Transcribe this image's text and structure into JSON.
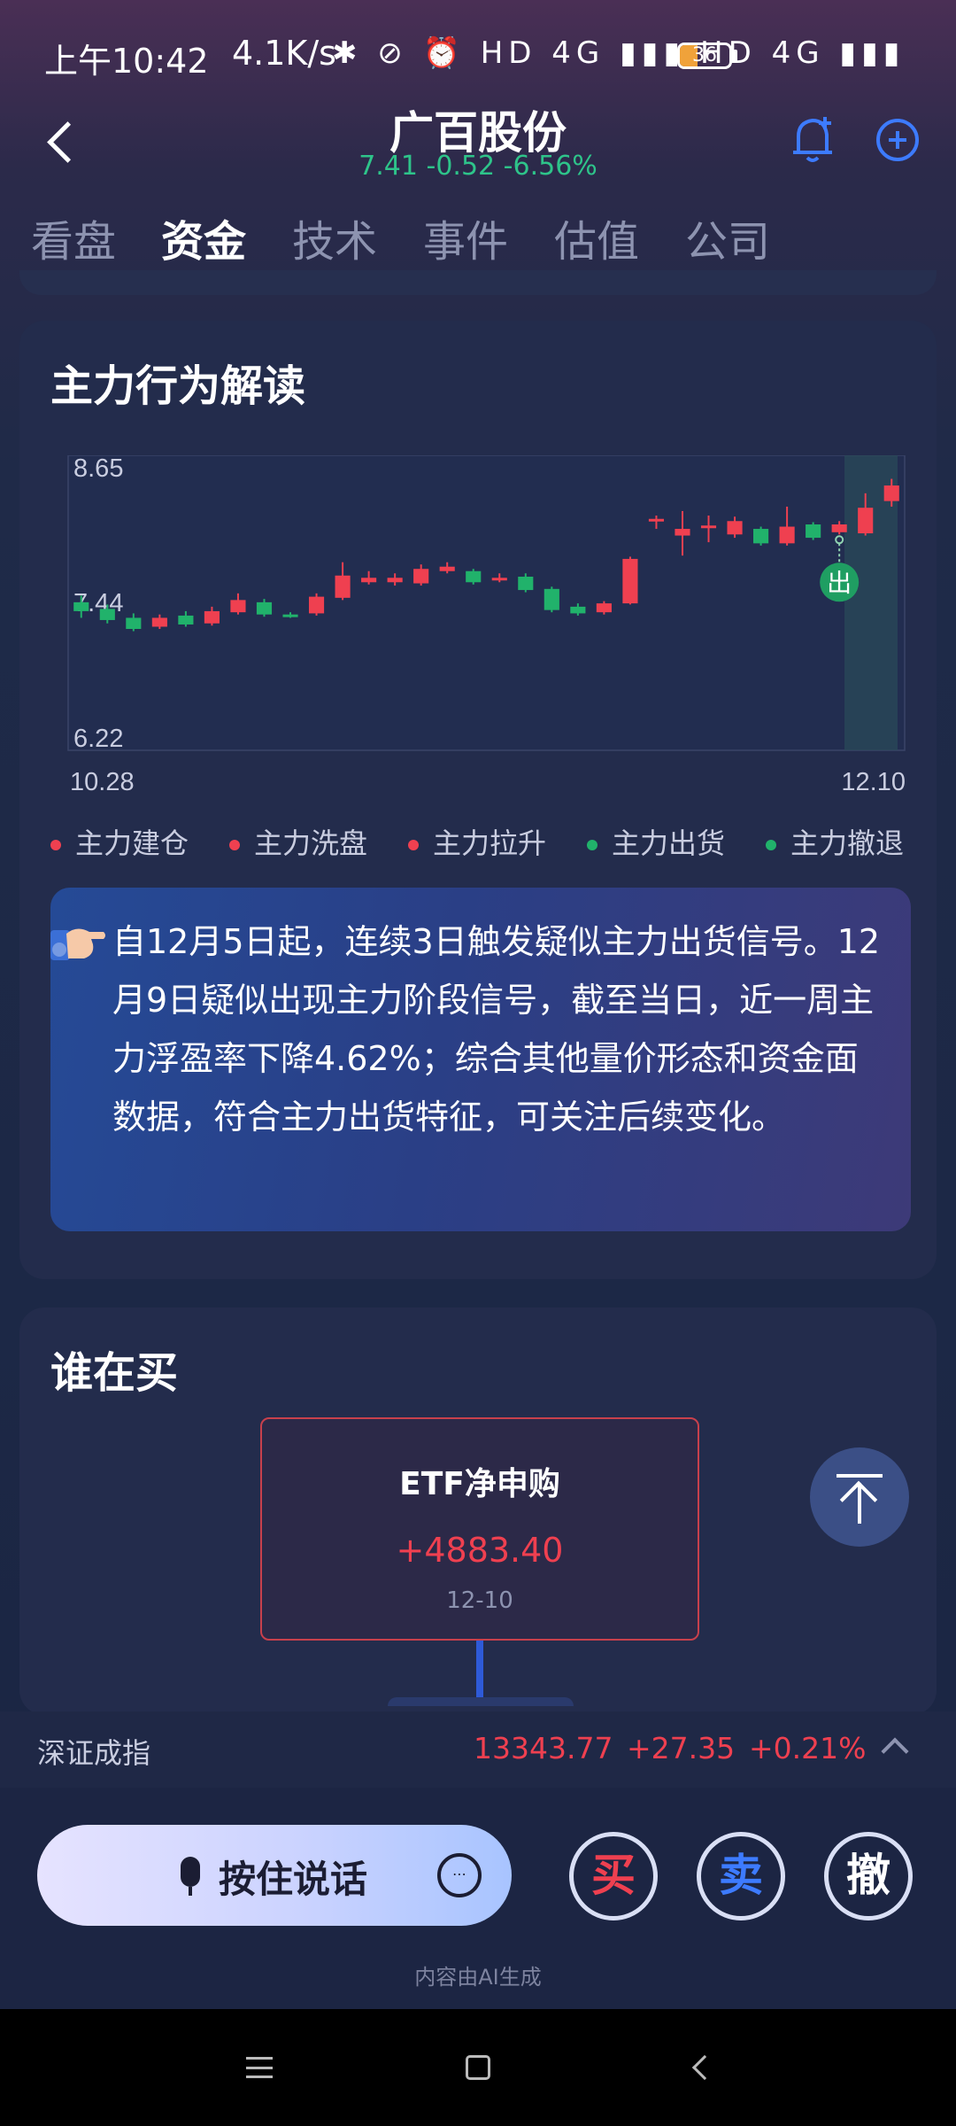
{
  "status_bar": {
    "time": "上午10:42",
    "net_rate": "4.1K/s",
    "indicators": "✱ ⊘ ⏰ HD 4G ▮▮▮ HD 4G ▮▮▮",
    "battery": "36",
    "battery_level": 0.36,
    "battery_color": "#f0a23a"
  },
  "header": {
    "stock_name": "广百股份",
    "quote": "7.41 -0.52 -6.56%",
    "quote_color": "#2ec48a",
    "icons": [
      "back-icon",
      "bell-plus-icon",
      "add-icon"
    ]
  },
  "tabs": [
    {
      "label": "看盘",
      "active": false
    },
    {
      "label": "资金",
      "active": true
    },
    {
      "label": "技术",
      "active": false
    },
    {
      "label": "事件",
      "active": false
    },
    {
      "label": "估值",
      "active": false
    },
    {
      "label": "公司",
      "active": false
    }
  ],
  "behavior_card": {
    "title": "主力行为解读",
    "legend": [
      {
        "label": "主力建仓",
        "color": "#ef4050"
      },
      {
        "label": "主力洗盘",
        "color": "#ef4050"
      },
      {
        "label": "主力拉升",
        "color": "#ef4050"
      },
      {
        "label": "主力出货",
        "color": "#21b26b"
      },
      {
        "label": "主力撤退",
        "color": "#21b26b"
      }
    ],
    "insight_text": "自12月5日起，连续3日触发疑似主力出货信号。12月9日疑似出现主力阶段信号，截至当日，近一周主力浮盈率下降4.62%；综合其他量价形态和资金面数据，符合主力出货特征，可关注后续变化。"
  },
  "chart_data": {
    "type": "candlestick",
    "title": "",
    "x_start_label": "10.28",
    "x_end_label": "12.10",
    "y_ticks": [
      "8.65",
      "7.44",
      "6.22"
    ],
    "ylim": [
      6.22,
      8.65
    ],
    "up_color": "#ef4050",
    "down_color": "#21b26b",
    "candles": [
      {
        "o": 7.44,
        "c": 7.36,
        "h": 7.5,
        "l": 7.3
      },
      {
        "o": 7.38,
        "c": 7.28,
        "h": 7.42,
        "l": 7.25
      },
      {
        "o": 7.3,
        "c": 7.2,
        "h": 7.34,
        "l": 7.18
      },
      {
        "o": 7.22,
        "c": 7.3,
        "h": 7.33,
        "l": 7.2
      },
      {
        "o": 7.32,
        "c": 7.24,
        "h": 7.36,
        "l": 7.22
      },
      {
        "o": 7.25,
        "c": 7.36,
        "h": 7.4,
        "l": 7.23
      },
      {
        "o": 7.35,
        "c": 7.46,
        "h": 7.52,
        "l": 7.33
      },
      {
        "o": 7.44,
        "c": 7.33,
        "h": 7.47,
        "l": 7.31
      },
      {
        "o": 7.33,
        "c": 7.31,
        "h": 7.35,
        "l": 7.3
      },
      {
        "o": 7.34,
        "c": 7.49,
        "h": 7.52,
        "l": 7.32
      },
      {
        "o": 7.48,
        "c": 7.68,
        "h": 7.8,
        "l": 7.46
      },
      {
        "o": 7.62,
        "c": 7.66,
        "h": 7.72,
        "l": 7.6
      },
      {
        "o": 7.62,
        "c": 7.66,
        "h": 7.7,
        "l": 7.59
      },
      {
        "o": 7.61,
        "c": 7.74,
        "h": 7.78,
        "l": 7.59
      },
      {
        "o": 7.72,
        "c": 7.76,
        "h": 7.8,
        "l": 7.7
      },
      {
        "o": 7.72,
        "c": 7.62,
        "h": 7.74,
        "l": 7.6
      },
      {
        "o": 7.64,
        "c": 7.66,
        "h": 7.7,
        "l": 7.62
      },
      {
        "o": 7.67,
        "c": 7.55,
        "h": 7.7,
        "l": 7.53
      },
      {
        "o": 7.56,
        "c": 7.37,
        "h": 7.58,
        "l": 7.35
      },
      {
        "o": 7.4,
        "c": 7.34,
        "h": 7.43,
        "l": 7.32
      },
      {
        "o": 7.35,
        "c": 7.43,
        "h": 7.45,
        "l": 7.33
      },
      {
        "o": 7.43,
        "c": 7.83,
        "h": 7.85,
        "l": 7.42
      },
      {
        "o": 8.17,
        "c": 8.19,
        "h": 8.22,
        "l": 8.1
      },
      {
        "o": 8.04,
        "c": 8.1,
        "h": 8.26,
        "l": 7.86
      },
      {
        "o": 8.12,
        "c": 8.13,
        "h": 8.22,
        "l": 7.98
      },
      {
        "o": 8.05,
        "c": 8.17,
        "h": 8.21,
        "l": 8.02
      },
      {
        "o": 8.1,
        "c": 7.97,
        "h": 8.12,
        "l": 7.95
      },
      {
        "o": 7.97,
        "c": 8.12,
        "h": 8.3,
        "l": 7.95
      },
      {
        "o": 8.14,
        "c": 8.02,
        "h": 8.16,
        "l": 8.0
      },
      {
        "o": 8.07,
        "c": 8.14,
        "h": 8.17,
        "l": 8.05
      },
      {
        "o": 8.06,
        "c": 8.29,
        "h": 8.42,
        "l": 8.04
      },
      {
        "o": 8.35,
        "c": 8.49,
        "h": 8.55,
        "l": 8.3
      }
    ],
    "signal": {
      "index": 29,
      "label": "出",
      "color": "#1f9e62"
    }
  },
  "who_buys_card": {
    "title": "谁在买",
    "flow_label": "ETF净申购",
    "flow_value": "+4883.40",
    "flow_date": "12-10"
  },
  "index_bar": {
    "name": "深证成指",
    "value": "13343.77",
    "change": "+27.35",
    "pct": "+0.21%"
  },
  "actions": {
    "voice_label": "按住说话",
    "buy_label": "买",
    "sell_label": "卖",
    "cancel_label": "撤",
    "buy_color": "#ef4050",
    "sell_color": "#3d7bff",
    "cancel_color": "#ffffff",
    "ai_note": "内容由AI生成"
  }
}
